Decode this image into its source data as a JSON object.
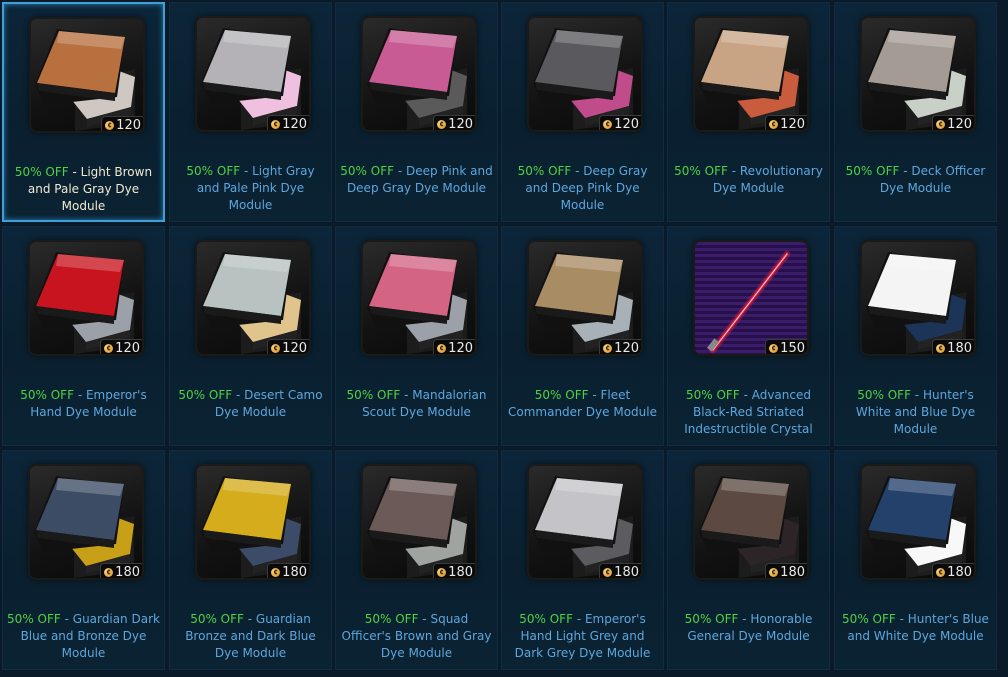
{
  "items": [
    {
      "discount": "50% OFF",
      "name": "Light Brown and Pale Gray Dye Module",
      "price": "120",
      "primary": "#b8703e",
      "secondary": "#cfc8c2",
      "kind": "dye",
      "selected": true
    },
    {
      "discount": "50% OFF",
      "name": "Light Gray and Pale Pink Dye Module",
      "price": "120",
      "primary": "#b4b2b6",
      "secondary": "#f0c0e0",
      "kind": "dye",
      "selected": false
    },
    {
      "discount": "50% OFF",
      "name": "Deep Pink and Deep Gray Dye Module",
      "price": "120",
      "primary": "#c85a94",
      "secondary": "#5a5a5a",
      "kind": "dye",
      "selected": false
    },
    {
      "discount": "50% OFF",
      "name": "Deep Gray and Deep Pink Dye Module",
      "price": "120",
      "primary": "#5a5a5e",
      "secondary": "#c04c8c",
      "kind": "dye",
      "selected": false
    },
    {
      "discount": "50% OFF",
      "name": "Revolutionary Dye Module",
      "price": "120",
      "primary": "#c8a484",
      "secondary": "#c85c3c",
      "kind": "dye",
      "selected": false
    },
    {
      "discount": "50% OFF",
      "name": "Deck Officer Dye Module",
      "price": "120",
      "primary": "#a49c94",
      "secondary": "#c8d0c8",
      "kind": "dye",
      "selected": false
    },
    {
      "discount": "50% OFF",
      "name": "Emperor's Hand Dye Module",
      "price": "120",
      "primary": "#c8141e",
      "secondary": "#9ca0a8",
      "kind": "dye",
      "selected": false
    },
    {
      "discount": "50% OFF",
      "name": "Desert Camo Dye Module",
      "price": "120",
      "primary": "#b8c2c0",
      "secondary": "#e0c48c",
      "kind": "dye",
      "selected": false
    },
    {
      "discount": "50% OFF",
      "name": "Mandalorian Scout Dye Module",
      "price": "120",
      "primary": "#d46484",
      "secondary": "#9ca0a8",
      "kind": "dye",
      "selected": false
    },
    {
      "discount": "50% OFF",
      "name": "Fleet Commander Dye Module",
      "price": "120",
      "primary": "#a88c64",
      "secondary": "#a8b0b8",
      "kind": "dye",
      "selected": false
    },
    {
      "discount": "50% OFF",
      "name": "Advanced Black-Red Striated Indestructible Crystal",
      "price": "150",
      "primary": "#e8203c",
      "secondary": "#3a1c6a",
      "kind": "saber",
      "selected": false
    },
    {
      "discount": "50% OFF",
      "name": "Hunter's White and Blue Dye Module",
      "price": "180",
      "primary": "#f4f4f4",
      "secondary": "#1c3458",
      "kind": "dye",
      "selected": false
    },
    {
      "discount": "50% OFF",
      "name": "Guardian Dark Blue and Bronze Dye Module",
      "price": "180",
      "primary": "#3c4c64",
      "secondary": "#c8a018",
      "kind": "dye",
      "selected": false
    },
    {
      "discount": "50% OFF",
      "name": "Guardian Bronze and Dark Blue Dye Module",
      "price": "180",
      "primary": "#d4ac1c",
      "secondary": "#3c4c68",
      "kind": "dye",
      "selected": false
    },
    {
      "discount": "50% OFF",
      "name": "Squad Officer's Brown and Gray Dye Module",
      "price": "180",
      "primary": "#6c5a58",
      "secondary": "#a0a4a0",
      "kind": "dye",
      "selected": false
    },
    {
      "discount": "50% OFF",
      "name": "Emperor's Hand Light Grey and Dark Grey Dye Module",
      "price": "180",
      "primary": "#c4c4c8",
      "secondary": "#5c5c60",
      "kind": "dye",
      "selected": false
    },
    {
      "discount": "50% OFF",
      "name": "Honorable General Dye Module",
      "price": "180",
      "primary": "#5c4a42",
      "secondary": "#2c2426",
      "kind": "dye",
      "selected": false
    },
    {
      "discount": "50% OFF",
      "name": "Hunter's Blue and White Dye Module",
      "price": "180",
      "primary": "#24416c",
      "secondary": "#f8f8f8",
      "kind": "dye",
      "selected": false
    }
  ]
}
